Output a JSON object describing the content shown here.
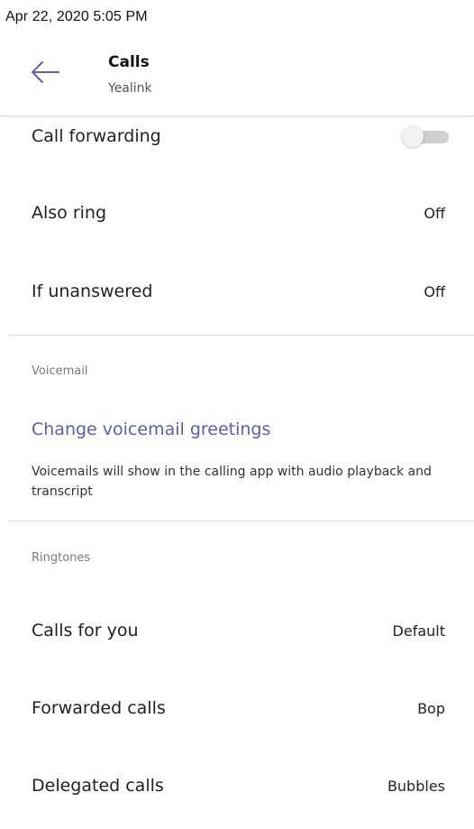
{
  "status_bar": {
    "datetime": "Apr 22, 2020  5:05 PM"
  },
  "header": {
    "title": "Calls",
    "subtitle": "Yealink",
    "back_icon": "arrow-left-icon"
  },
  "forwarding": {
    "call_forwarding_label": "Call forwarding",
    "call_forwarding_enabled": false,
    "also_ring_label": "Also ring",
    "also_ring_value": "Off",
    "if_unanswered_label": "If unanswered",
    "if_unanswered_value": "Off"
  },
  "voicemail": {
    "section_label": "Voicemail",
    "change_greetings_link": "Change voicemail greetings",
    "description": "Voicemails will show in the calling app with audio playback and transcript"
  },
  "ringtones": {
    "section_label": "Ringtones",
    "items": [
      {
        "label": "Calls for you",
        "value": "Default"
      },
      {
        "label": "Forwarded calls",
        "value": "Bop"
      },
      {
        "label": "Delegated calls",
        "value": "Bubbles"
      }
    ]
  },
  "colors": {
    "link": "#5a5ea8",
    "back_arrow": "#6264a7",
    "toggle_track": "#cfcfcf"
  }
}
